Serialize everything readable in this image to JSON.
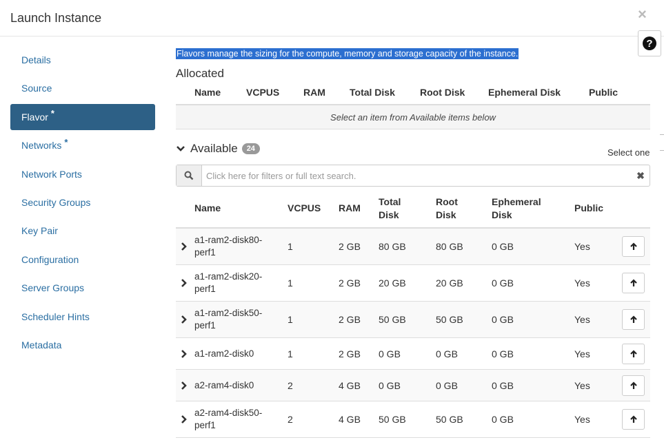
{
  "modal": {
    "title": "Launch Instance",
    "close_glyph": "×",
    "help_glyph": "?"
  },
  "nav": {
    "items": [
      {
        "label": "Details",
        "required": false,
        "active": false
      },
      {
        "label": "Source",
        "required": false,
        "active": false
      },
      {
        "label": "Flavor",
        "required": true,
        "active": true
      },
      {
        "label": "Networks",
        "required": true,
        "active": false
      },
      {
        "label": "Network Ports",
        "required": false,
        "active": false
      },
      {
        "label": "Security Groups",
        "required": false,
        "active": false
      },
      {
        "label": "Key Pair",
        "required": false,
        "active": false
      },
      {
        "label": "Configuration",
        "required": false,
        "active": false
      },
      {
        "label": "Server Groups",
        "required": false,
        "active": false
      },
      {
        "label": "Scheduler Hints",
        "required": false,
        "active": false
      },
      {
        "label": "Metadata",
        "required": false,
        "active": false
      }
    ],
    "required_marker": "*"
  },
  "flavor": {
    "help_text": "Flavors manage the sizing for the compute, memory and storage capacity of the instance.",
    "allocated": {
      "title": "Allocated",
      "columns": [
        "Name",
        "VCPUS",
        "RAM",
        "Total Disk",
        "Root Disk",
        "Ephemeral Disk",
        "Public"
      ],
      "empty_message": "Select an item from Available items below"
    },
    "available": {
      "title": "Available",
      "count": "24",
      "select_hint": "Select one",
      "search_placeholder": "Click here for filters or full text search.",
      "clear_glyph": "✖",
      "columns": {
        "name": "Name",
        "vcpus": "VCPUS",
        "ram": "RAM",
        "total_disk": [
          "Total",
          "Disk"
        ],
        "root_disk": [
          "Root",
          "Disk"
        ],
        "ephemeral_disk": [
          "Ephemeral",
          "Disk"
        ],
        "public": "Public"
      },
      "rows": [
        {
          "name": "a1-ram2-disk80-perf1",
          "vcpus": "1",
          "ram": "2 GB",
          "total_disk": "80 GB",
          "root_disk": "80 GB",
          "ephemeral_disk": "0 GB",
          "public": "Yes"
        },
        {
          "name": "a1-ram2-disk20-perf1",
          "vcpus": "1",
          "ram": "2 GB",
          "total_disk": "20 GB",
          "root_disk": "20 GB",
          "ephemeral_disk": "0 GB",
          "public": "Yes"
        },
        {
          "name": "a1-ram2-disk50-perf1",
          "vcpus": "1",
          "ram": "2 GB",
          "total_disk": "50 GB",
          "root_disk": "50 GB",
          "ephemeral_disk": "0 GB",
          "public": "Yes"
        },
        {
          "name": "a1-ram2-disk0",
          "vcpus": "1",
          "ram": "2 GB",
          "total_disk": "0 GB",
          "root_disk": "0 GB",
          "ephemeral_disk": "0 GB",
          "public": "Yes"
        },
        {
          "name": "a2-ram4-disk0",
          "vcpus": "2",
          "ram": "4 GB",
          "total_disk": "0 GB",
          "root_disk": "0 GB",
          "ephemeral_disk": "0 GB",
          "public": "Yes"
        },
        {
          "name": "a2-ram4-disk50-perf1",
          "vcpus": "2",
          "ram": "4 GB",
          "total_disk": "50 GB",
          "root_disk": "50 GB",
          "ephemeral_disk": "0 GB",
          "public": "Yes"
        }
      ]
    }
  },
  "colors": {
    "nav_active_bg": "#2d6086",
    "link": "#2a6ea2",
    "selection_highlight": "#2c6fd0"
  }
}
